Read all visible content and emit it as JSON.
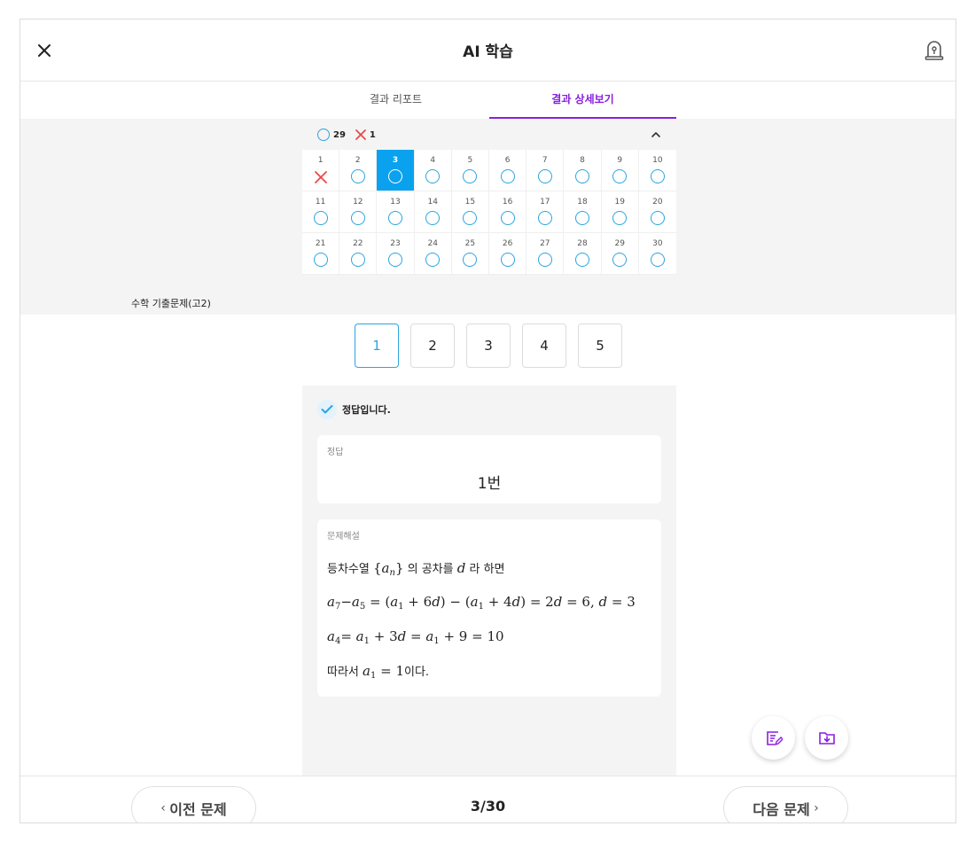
{
  "header": {
    "title": "AI 학습",
    "close_icon": "close-icon",
    "report_icon": "siren-icon"
  },
  "tabs": [
    {
      "label": "결과 리포트",
      "active": false
    },
    {
      "label": "결과 상세보기",
      "active": true
    }
  ],
  "summary": {
    "correct_count": "29",
    "wrong_count": "1"
  },
  "questions": [
    {
      "n": "1",
      "r": "x"
    },
    {
      "n": "2",
      "r": "o"
    },
    {
      "n": "3",
      "r": "o",
      "active": true
    },
    {
      "n": "4",
      "r": "o"
    },
    {
      "n": "5",
      "r": "o"
    },
    {
      "n": "6",
      "r": "o"
    },
    {
      "n": "7",
      "r": "o"
    },
    {
      "n": "8",
      "r": "o"
    },
    {
      "n": "9",
      "r": "o"
    },
    {
      "n": "10",
      "r": "o"
    },
    {
      "n": "11",
      "r": "o"
    },
    {
      "n": "12",
      "r": "o"
    },
    {
      "n": "13",
      "r": "o"
    },
    {
      "n": "14",
      "r": "o"
    },
    {
      "n": "15",
      "r": "o"
    },
    {
      "n": "16",
      "r": "o"
    },
    {
      "n": "17",
      "r": "o"
    },
    {
      "n": "18",
      "r": "o"
    },
    {
      "n": "19",
      "r": "o"
    },
    {
      "n": "20",
      "r": "o"
    },
    {
      "n": "21",
      "r": "o"
    },
    {
      "n": "22",
      "r": "o"
    },
    {
      "n": "23",
      "r": "o"
    },
    {
      "n": "24",
      "r": "o"
    },
    {
      "n": "25",
      "r": "o"
    },
    {
      "n": "26",
      "r": "o"
    },
    {
      "n": "27",
      "r": "o"
    },
    {
      "n": "28",
      "r": "o"
    },
    {
      "n": "29",
      "r": "o"
    },
    {
      "n": "30",
      "r": "o"
    }
  ],
  "subject": "수학 기출문제(고2)",
  "options": [
    "1",
    "2",
    "3",
    "4",
    "5"
  ],
  "selected_option": "1",
  "result_text": "정답입니다.",
  "answer": {
    "label": "정답",
    "value": "1번"
  },
  "explanation": {
    "label": "문제해설",
    "line1_pre": "등차수열",
    "line1_mid": "의 공차를",
    "line1_post": "라 하면",
    "line4_pre": "따라서",
    "line4_post": "이다."
  },
  "footer": {
    "prev_label": "이전 문제",
    "next_label": "다음 문제",
    "counter": "3/30"
  },
  "colors": {
    "accent_purple": "#8a1fe0",
    "correct_blue": "#2ba5e0",
    "active_cell": "#0aa2ef",
    "wrong_red": "#e84a4a"
  }
}
